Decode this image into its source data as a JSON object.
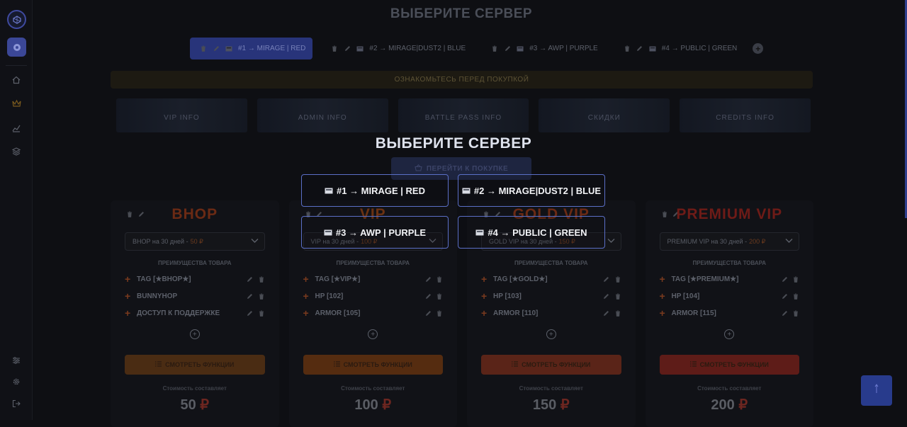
{
  "page_title": "ВЫБЕРИТЕ СЕРВЕР",
  "tabs": [
    {
      "label": "#1 → MIRAGE | RED",
      "active": true
    },
    {
      "label": "#2 → MIRAGE|DUST2 | BLUE",
      "active": false
    },
    {
      "label": "#3 → AWP | PURPLE",
      "active": false
    },
    {
      "label": "#4 → PUBLIC | GREEN",
      "active": false
    }
  ],
  "notice": "ОЗНАКОМЬТЕСЬ ПЕРЕД ПОКУПКОЙ",
  "banners": [
    "VIP INFO",
    "ADMIN INFO",
    "BATTLE PASS INFO",
    "СКИДКИ",
    "CREDITS INFO"
  ],
  "buy_button": "ПЕРЕЙТИ К ПОКУПКЕ",
  "cards": [
    {
      "name": "BHOP",
      "name_color": "#6b2a14",
      "select": "BHOP на 30 дней - ",
      "select_price": "50 ₽",
      "advantages_title": "ПРЕИМУЩЕСТВА ТОВАРА",
      "features": [
        "TAG [★BHOP★]",
        "BUNNYHOP",
        "ДОСТУП К ПОДДЕРЖКЕ"
      ],
      "func_button": "СМОТРЕТЬ ФУНКЦИИ",
      "func_color": "#4a2c13",
      "cost_label": "Стоимость составляет",
      "price": "50",
      "currency": "₽"
    },
    {
      "name": "VIP",
      "name_color": "#6b3212",
      "select": "VIP на 30 дней - ",
      "select_price": "100 ₽",
      "advantages_title": "ПРЕИМУЩЕСТВА ТОВАРА",
      "features": [
        "TAG [★VIP★]",
        "HP [102]",
        "ARMOR [105]"
      ],
      "func_button": "СМОТРЕТЬ ФУНКЦИИ",
      "func_color": "#552c10",
      "cost_label": "Стоимость составляет",
      "price": "100",
      "currency": "₽"
    },
    {
      "name": "GOLD VIP",
      "name_color": "#6b2a14",
      "select": "GOLD VIP на 30 дней - ",
      "select_price": "150 ₽",
      "advantages_title": "ПРЕИМУЩЕСТВА ТОВАРА",
      "features": [
        "TAG [★GOLD★]",
        "HP [103]",
        "ARMOR [110]"
      ],
      "func_button": "СМОТРЕТЬ ФУНКЦИИ",
      "func_color": "#5a2418",
      "cost_label": "Стоимость составляет",
      "price": "150",
      "currency": "₽"
    },
    {
      "name": "PREMIUM VIP",
      "name_color": "#6e1b17",
      "select": "PREMIUM VIP на 30 дней - ",
      "select_price": "200 ₽",
      "advantages_title": "ПРЕИМУЩЕСТВА ТОВАРА",
      "features": [
        "TAG [★PREMIUM★]",
        "HP [104]",
        "ARMOR [115]"
      ],
      "func_button": "СМОТРЕТЬ ФУНКЦИИ",
      "func_color": "#5e1c18",
      "cost_label": "Стоимость составляет",
      "price": "200",
      "currency": "₽"
    }
  ],
  "modal": {
    "title": "ВЫБЕРИТЕ СЕРВЕР",
    "servers": [
      "#1 → MIRAGE | RED",
      "#2 → MIRAGE|DUST2 | BLUE",
      "#3 → AWP | PURPLE",
      "#4 → PUBLIC | GREEN"
    ]
  },
  "icons": {
    "sidebar_top": [
      "logo-icon",
      "target-icon"
    ],
    "sidebar_nav": [
      "home-icon",
      "crown-icon",
      "chart-icon",
      "layers-icon"
    ],
    "sidebar_bottom": [
      "sliders-icon",
      "gear-icon",
      "logout-icon"
    ]
  }
}
